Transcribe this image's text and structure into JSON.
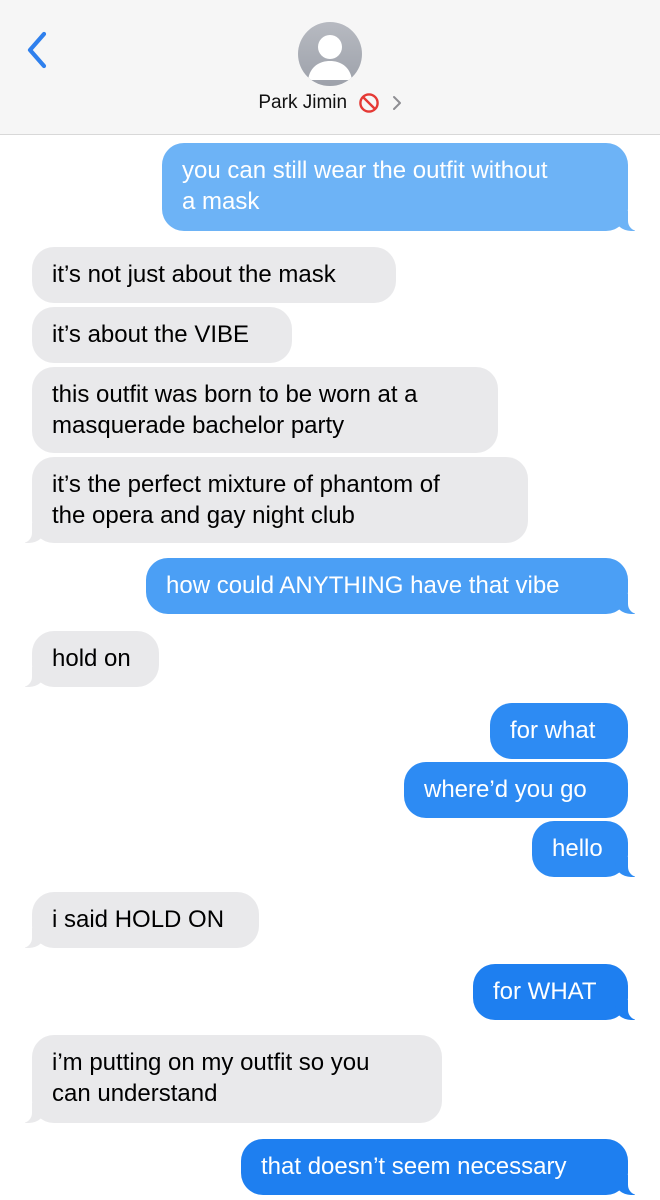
{
  "header": {
    "contact_name": "Park Jimin",
    "status_icon": "no-entry-icon",
    "back_icon": "chevron-left-icon",
    "detail_icon": "chevron-right-icon",
    "accent_color": "#2f80ed"
  },
  "messages": [
    {
      "from": "me",
      "lines": [
        "you can still wear the outfit without",
        "a mask"
      ]
    },
    {
      "from": "them",
      "lines": [
        "it’s not just about the mask"
      ]
    },
    {
      "from": "them",
      "lines": [
        "it’s about the VIBE"
      ]
    },
    {
      "from": "them",
      "lines": [
        "this outfit was born to be worn at a",
        "masquerade bachelor party"
      ]
    },
    {
      "from": "them",
      "lines": [
        "it’s the perfect mixture of phantom of",
        "the opera and gay night club"
      ]
    },
    {
      "from": "me",
      "lines": [
        "how could ANYTHING have that vibe"
      ]
    },
    {
      "from": "them",
      "lines": [
        "hold on"
      ]
    },
    {
      "from": "me",
      "lines": [
        "for what"
      ]
    },
    {
      "from": "me",
      "lines": [
        "where’d you go"
      ]
    },
    {
      "from": "me",
      "lines": [
        "hello"
      ]
    },
    {
      "from": "them",
      "lines": [
        "i said HOLD ON"
      ]
    },
    {
      "from": "me",
      "lines": [
        "for WHAT"
      ]
    },
    {
      "from": "them",
      "lines": [
        "i’m putting on my outfit so you",
        "can understand"
      ]
    },
    {
      "from": "me",
      "lines": [
        "that doesn’t seem necessary"
      ]
    }
  ]
}
